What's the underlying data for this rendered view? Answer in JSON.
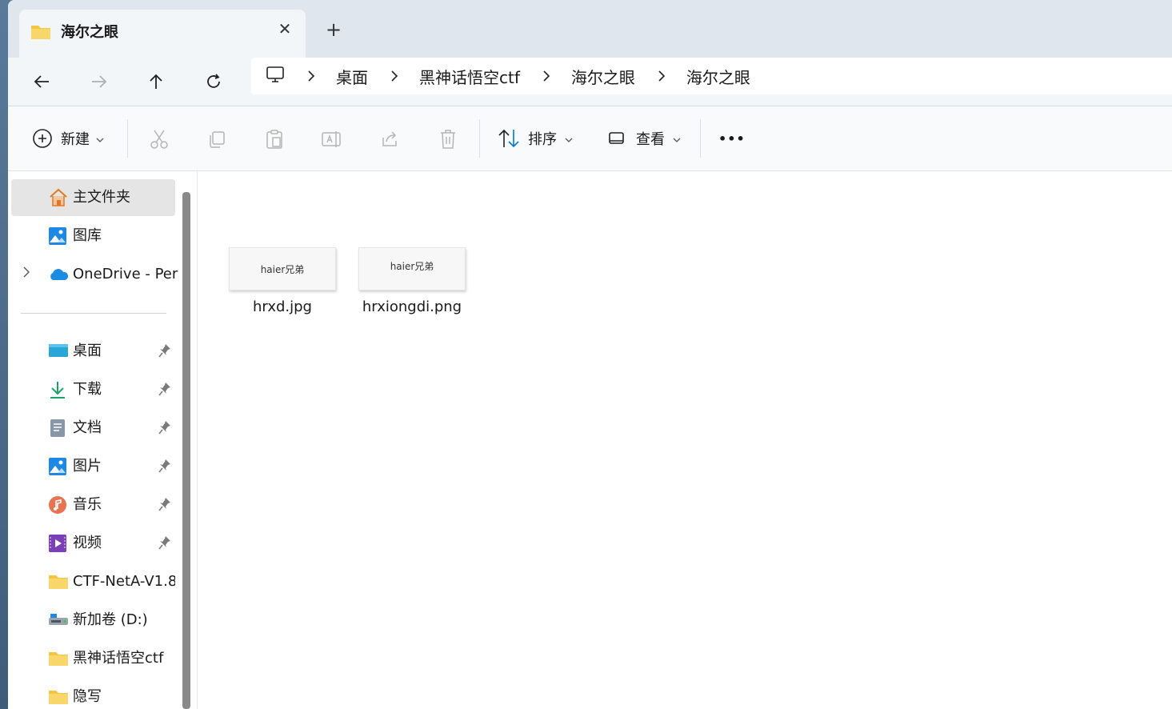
{
  "window": {
    "tab_title": "海尔之眼",
    "newtab_symbol": "+",
    "close_symbol": "✕"
  },
  "address": {
    "crumbs": [
      "桌面",
      "黑神话悟空ctf",
      "海尔之眼",
      "海尔之眼"
    ]
  },
  "toolbar": {
    "new_label": "新建",
    "sort_label": "排序",
    "view_label": "查看",
    "more_label": "•••"
  },
  "sidebar": {
    "items": [
      {
        "label": "主文件夹",
        "icon": "home-icon"
      },
      {
        "label": "图库",
        "icon": "gallery-icon"
      },
      {
        "label": "OneDrive - Per",
        "icon": "onedrive-icon"
      },
      {
        "label": "桌面",
        "icon": "desktop-icon",
        "pinned": true
      },
      {
        "label": "下载",
        "icon": "download-icon",
        "pinned": true
      },
      {
        "label": "文档",
        "icon": "documents-icon",
        "pinned": true
      },
      {
        "label": "图片",
        "icon": "pictures-icon",
        "pinned": true
      },
      {
        "label": "音乐",
        "icon": "music-icon",
        "pinned": true
      },
      {
        "label": "视频",
        "icon": "videos-icon",
        "pinned": true
      },
      {
        "label": "CTF-NetA-V1.8",
        "icon": "folder-icon"
      },
      {
        "label": "新加卷 (D:)",
        "icon": "drive-icon"
      },
      {
        "label": "黑神话悟空ctf",
        "icon": "folder-icon"
      },
      {
        "label": "隐写",
        "icon": "folder-icon"
      }
    ]
  },
  "files": [
    {
      "name": "hrxd.jpg",
      "thumb_text": "haier兄弟"
    },
    {
      "name": "hrxiongdi.png",
      "thumb_text": "haier兄弟"
    }
  ],
  "colors": {
    "accent": "#0078d4",
    "folder": "#f4c542",
    "selection": "#e5e5e5"
  }
}
